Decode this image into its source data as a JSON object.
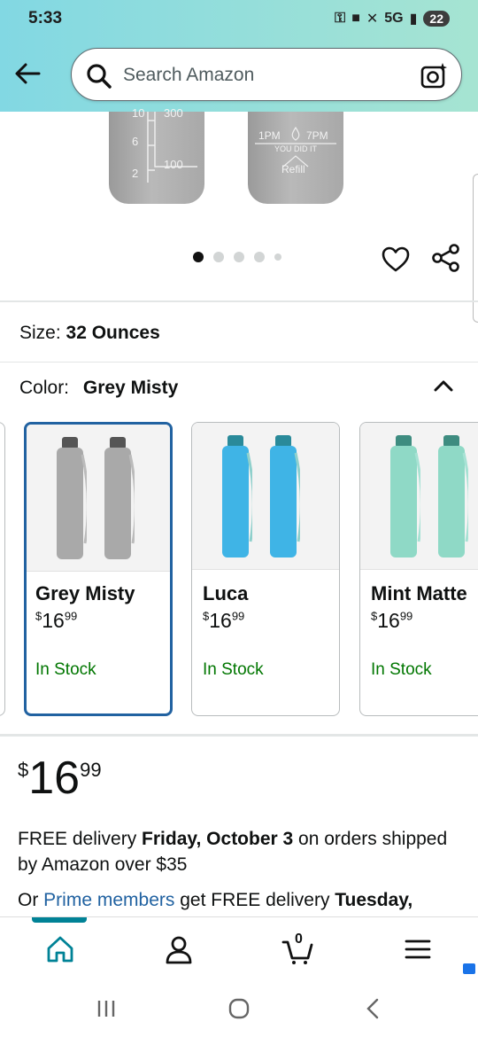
{
  "status_bar": {
    "time": "5:33",
    "network": "5G",
    "battery": "22"
  },
  "search": {
    "placeholder": "Search Amazon"
  },
  "hero": {
    "bottle1_marks": [
      "10",
      "300",
      "6",
      "2",
      "100"
    ],
    "bottle2_marks": [
      "1PM",
      "7PM",
      "YOU DID IT",
      "Refill"
    ],
    "carousel_dots": 5,
    "carousel_active": 1
  },
  "size": {
    "label": "Size:",
    "value": "32 Ounces"
  },
  "color": {
    "label": "Color:",
    "value": "Grey Misty"
  },
  "variants": [
    {
      "name": "Grey Misty",
      "currency": "$",
      "whole": "16",
      "fraction": "99",
      "stock": "In Stock",
      "selected": true,
      "color": "#a9a9a9"
    },
    {
      "name": "Luca",
      "currency": "$",
      "whole": "16",
      "fraction": "99",
      "stock": "In Stock",
      "selected": false,
      "color": "#3fb4e6"
    },
    {
      "name": "Mint Matte",
      "currency": "$",
      "whole": "16",
      "fraction": "99",
      "stock": "In Stock",
      "selected": false,
      "color": "#8fd9c6"
    }
  ],
  "price": {
    "currency": "$",
    "whole": "16",
    "fraction": "99"
  },
  "delivery": {
    "prefix": "FREE delivery ",
    "date": "Friday, October 3",
    "suffix": " on orders shipped by Amazon over $35"
  },
  "prime_line": {
    "prefix": "Or ",
    "link": "Prime members",
    "middle": " get FREE delivery ",
    "date": "Tuesday,"
  },
  "bottom_nav": {
    "cart_count": "0"
  },
  "colors": {
    "accent": "#008296",
    "link": "#2162a1",
    "in_stock": "#007600",
    "selected_border": "#2162a1"
  }
}
